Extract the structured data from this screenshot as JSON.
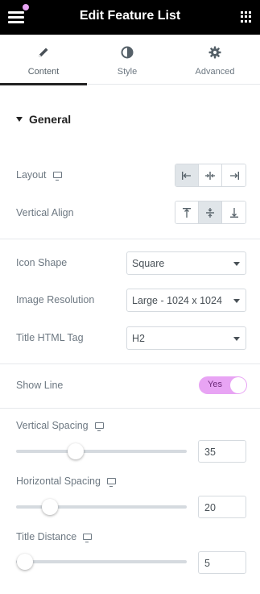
{
  "header": {
    "title": "Edit Feature List",
    "accent_dot_color": "#e8a4f4"
  },
  "tabs": [
    {
      "label": "Content",
      "icon": "pencil-icon",
      "active": true
    },
    {
      "label": "Style",
      "icon": "half-circle-icon",
      "active": false
    },
    {
      "label": "Advanced",
      "icon": "gear-icon",
      "active": false
    }
  ],
  "section": {
    "title": "General"
  },
  "layout": {
    "label": "Layout",
    "icon": "desktop-icon",
    "options": [
      "align-left",
      "align-center",
      "align-right"
    ],
    "selected": "align-left"
  },
  "vertical_align": {
    "label": "Vertical Align",
    "options": [
      "top",
      "middle",
      "bottom"
    ],
    "selected": "middle"
  },
  "icon_shape": {
    "label": "Icon Shape",
    "value": "Square"
  },
  "image_resolution": {
    "label": "Image Resolution",
    "value": "Large - 1024 x 1024"
  },
  "title_html_tag": {
    "label": "Title HTML Tag",
    "value": "H2"
  },
  "show_line": {
    "label": "Show Line",
    "value": "Yes",
    "color": "#e8a4f4"
  },
  "vertical_spacing": {
    "label": "Vertical Spacing",
    "icon": "desktop-icon",
    "value": "35"
  },
  "horizontal_spacing": {
    "label": "Horizontal Spacing",
    "icon": "desktop-icon",
    "value": "20"
  },
  "title_distance": {
    "label": "Title Distance",
    "icon": "desktop-icon",
    "value": "5"
  }
}
